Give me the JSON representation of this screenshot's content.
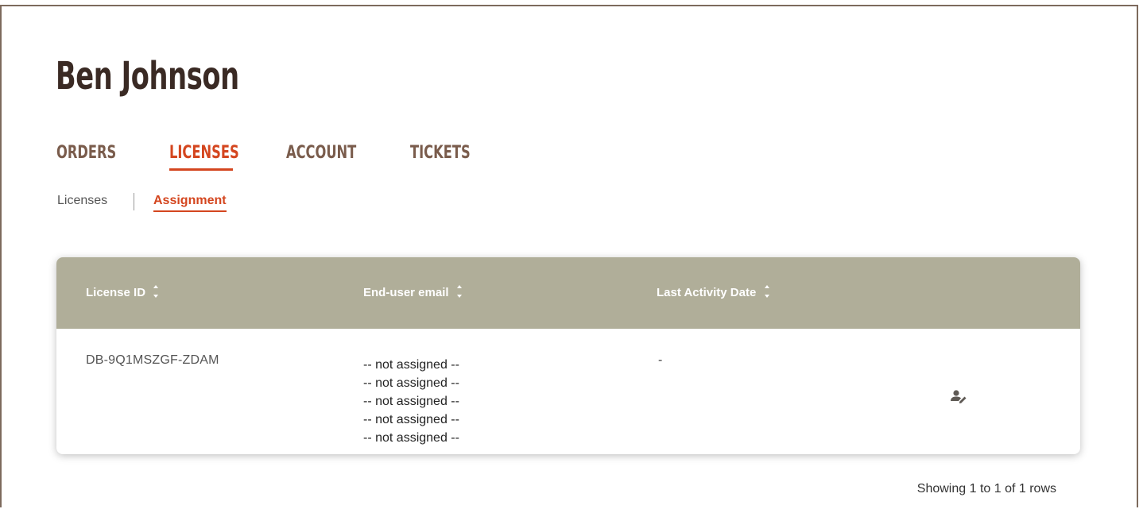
{
  "header": {
    "title": "Ben Johnson"
  },
  "tabs": [
    {
      "label": "ORDERS",
      "active": false
    },
    {
      "label": "LICENSES",
      "active": true
    },
    {
      "label": "ACCOUNT",
      "active": false
    },
    {
      "label": "TICKETS",
      "active": false
    }
  ],
  "subtabs": [
    {
      "label": "Licenses",
      "active": false
    },
    {
      "label": "Assignment",
      "active": true
    }
  ],
  "table": {
    "columns": [
      {
        "label": "License ID",
        "sortable": true
      },
      {
        "label": "End-user email",
        "sortable": true
      },
      {
        "label": "Last Activity Date",
        "sortable": true
      }
    ],
    "rows": [
      {
        "license_id": "DB-9Q1MSZGF-ZDAM",
        "emails": [
          "-- not assigned --",
          "-- not assigned --",
          "-- not assigned --",
          "-- not assigned --",
          "-- not assigned --"
        ],
        "last_activity": "-",
        "action_icon": "edit-user-icon"
      }
    ]
  },
  "footer": {
    "info": "Showing 1 to 1 of 1 rows"
  },
  "colors": {
    "accent": "#d4461f",
    "tab_inactive": "#7a5c4c",
    "title": "#3a2a24",
    "table_header_bg": "#b0ae99",
    "frame_border": "#7d6a5d"
  }
}
